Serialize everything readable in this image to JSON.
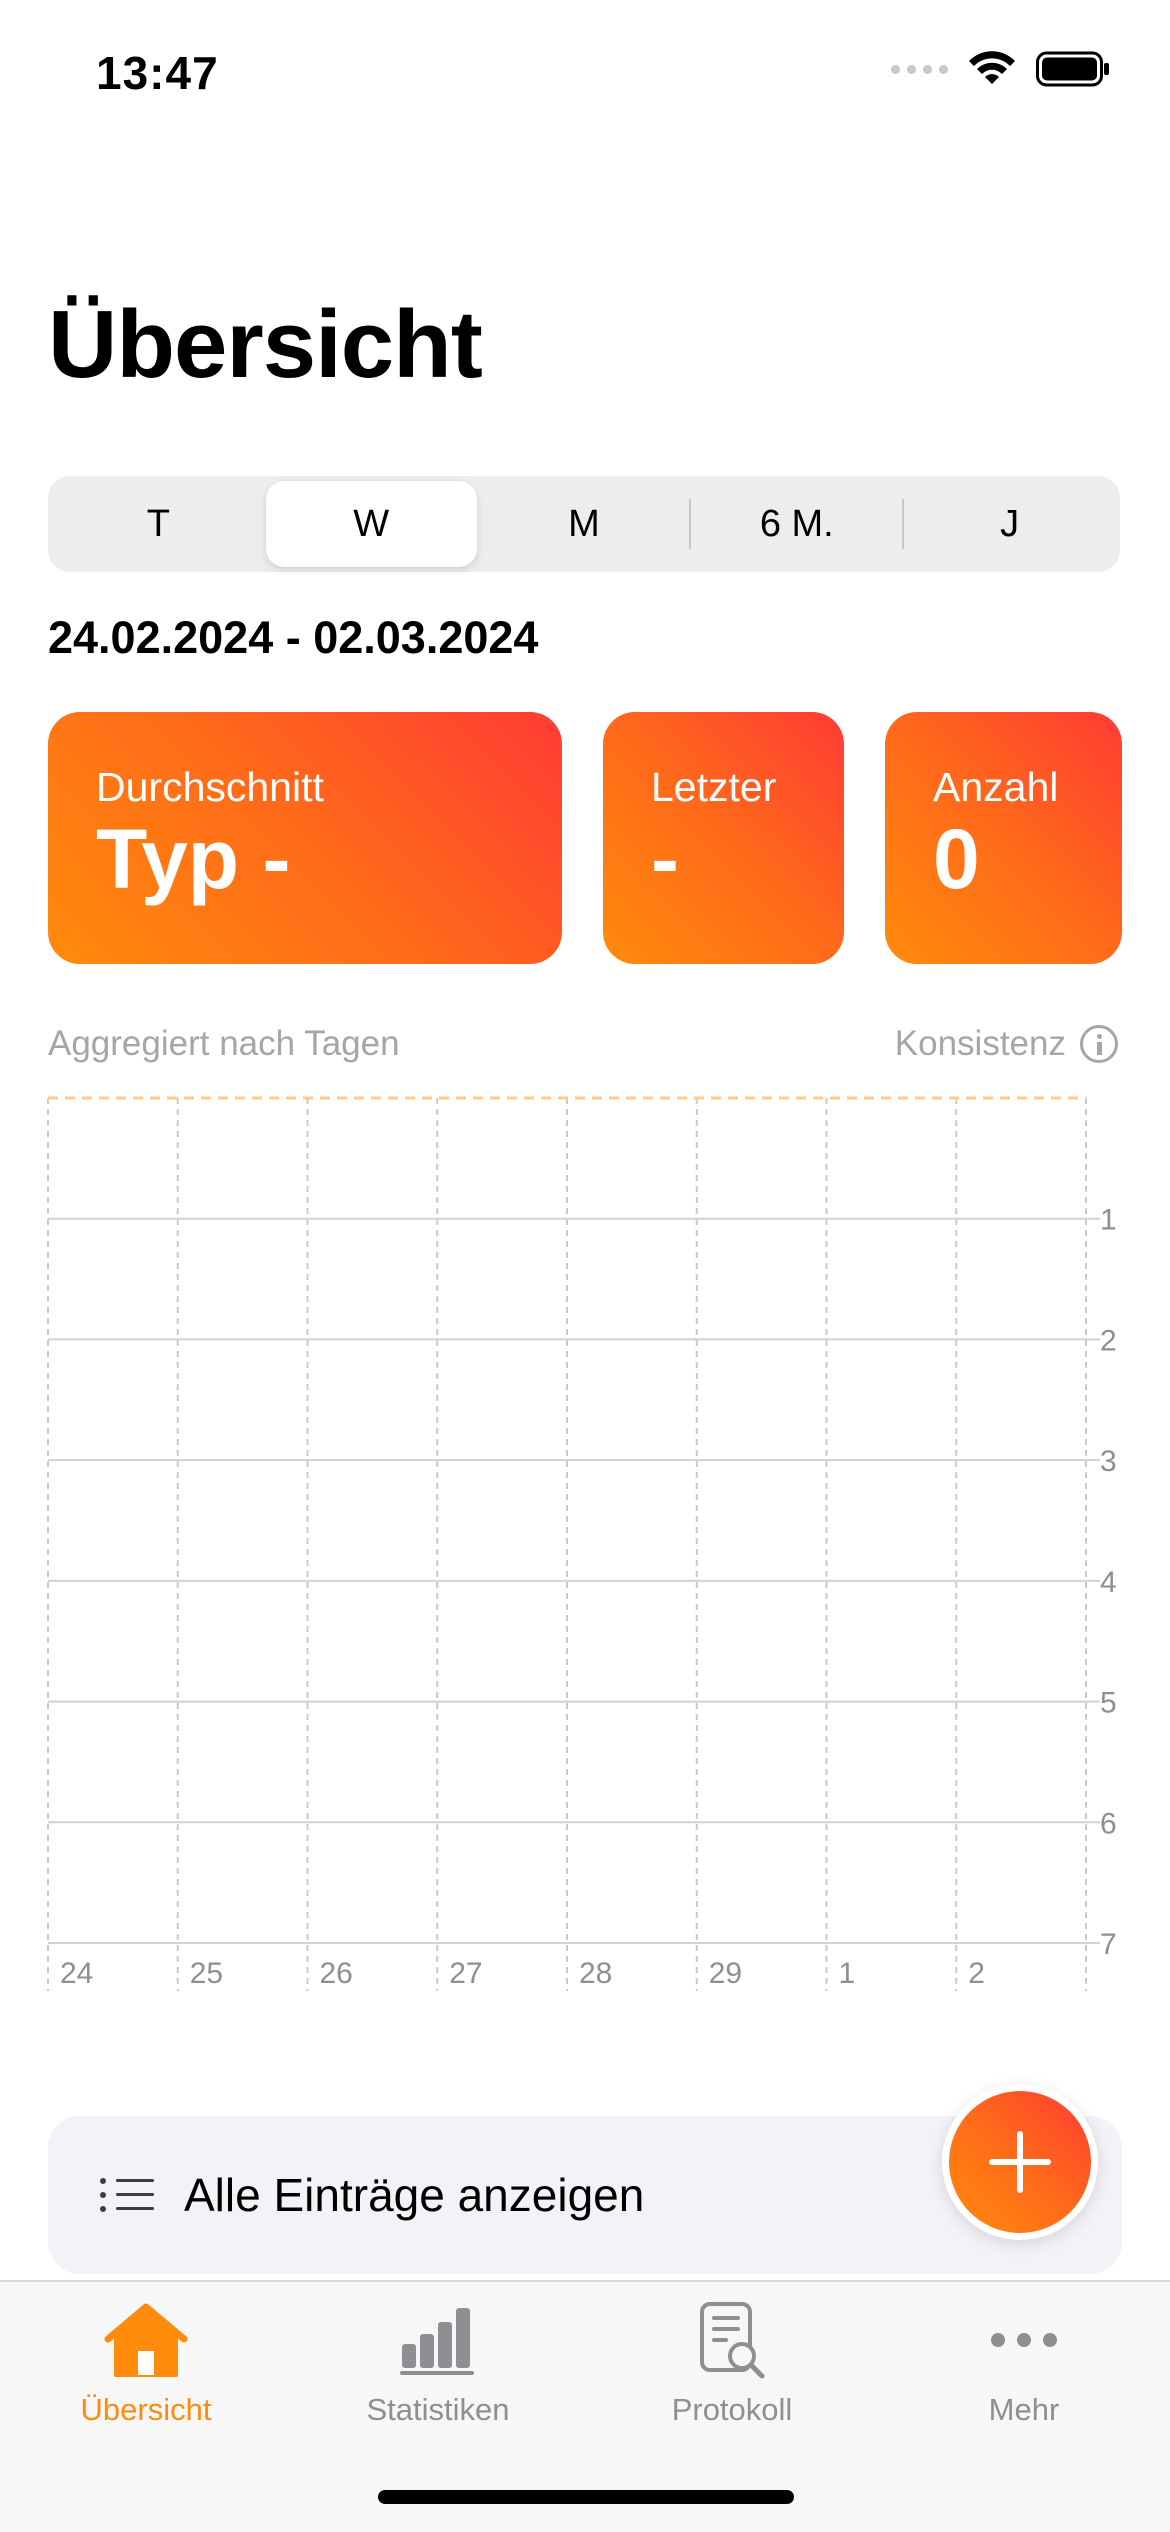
{
  "status_bar": {
    "time": "13:47"
  },
  "title": "Übersicht",
  "segments": [
    {
      "label": "T",
      "active": false
    },
    {
      "label": "W",
      "active": true
    },
    {
      "label": "M",
      "active": false
    },
    {
      "label": "6 M.",
      "active": false
    },
    {
      "label": "J",
      "active": false
    }
  ],
  "date_range": "24.02.2024 - 02.03.2024",
  "cards": {
    "average": {
      "label": "Durchschnitt",
      "value": "Typ -"
    },
    "last": {
      "label": "Letzter",
      "value": "-"
    },
    "count": {
      "label": "Anzahl",
      "value": "0"
    }
  },
  "chart_header": {
    "caption": "Aggregiert nach Tagen",
    "consistency": "Konsistenz"
  },
  "chart_data": {
    "type": "bar",
    "categories": [
      "24",
      "25",
      "26",
      "27",
      "28",
      "29",
      "1",
      "2"
    ],
    "values": [
      null,
      null,
      null,
      null,
      null,
      null,
      null,
      null
    ],
    "y_ticks": [
      "1",
      "2",
      "3",
      "4",
      "5",
      "6",
      "7"
    ],
    "ylim": [
      0,
      7
    ],
    "y_inverted": true,
    "grid": true,
    "title": "",
    "xlabel": "",
    "ylabel": ""
  },
  "show_all": {
    "label": "Alle Einträge anzeigen"
  },
  "tabs": [
    {
      "label": "Übersicht",
      "icon": "house-icon",
      "active": true
    },
    {
      "label": "Statistiken",
      "icon": "bar-chart-icon",
      "active": false
    },
    {
      "label": "Protokoll",
      "icon": "document-search-icon",
      "active": false
    },
    {
      "label": "Mehr",
      "icon": "more-icon",
      "active": false
    }
  ],
  "colors": {
    "accent": "#ff8b0c",
    "gradient_start": "#ff8b0c",
    "gradient_end": "#ff3b34",
    "tab_inactive": "#8e8e93",
    "target_line": "#ffcc80"
  }
}
